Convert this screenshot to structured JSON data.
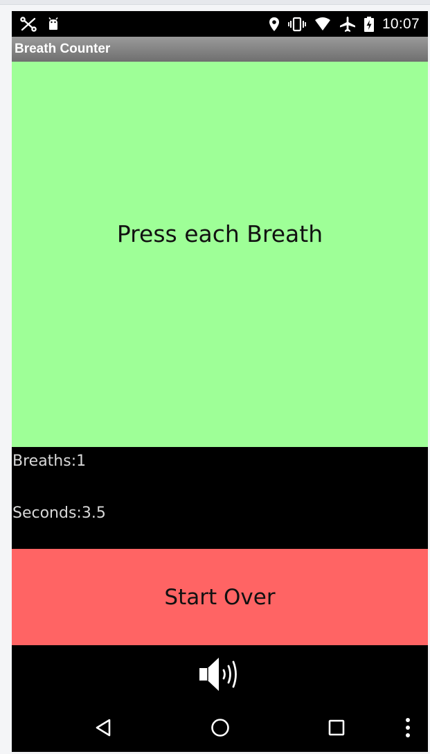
{
  "status_bar": {
    "left_icons": [
      "tools-icon",
      "android-icon"
    ],
    "right_icons": [
      "location-icon",
      "vibrate-icon",
      "wifi-icon",
      "airplane-icon",
      "battery-icon"
    ],
    "time": "10:07"
  },
  "app": {
    "title": "Breath Counter"
  },
  "main": {
    "breath_button_label": "Press each Breath",
    "breaths_text": "Breaths:1",
    "seconds_text": "Seconds:3.5",
    "start_over_label": "Start Over",
    "sound_icon": "speaker-volume-icon"
  },
  "nav_bar": {
    "icons": [
      "back-icon",
      "home-icon",
      "recents-icon",
      "overflow-menu-icon"
    ]
  },
  "colors": {
    "breath_button": "#9eff97",
    "start_over": "#ff6464",
    "title_bar": "#8a8a8a",
    "background": "#000000"
  }
}
